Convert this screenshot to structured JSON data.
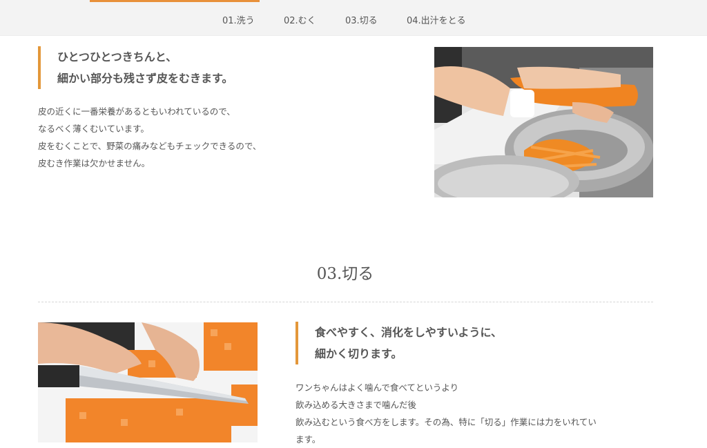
{
  "nav": {
    "items": [
      {
        "label": "01.洗う"
      },
      {
        "label": "02.むく"
      },
      {
        "label": "03.切る"
      },
      {
        "label": "04.出汁をとる"
      }
    ]
  },
  "peel_section": {
    "headline": [
      "ひとつひとつきちんと、",
      "細かい部分も残さず皮をむきます。"
    ],
    "body": [
      "皮の近くに一番栄養があるともいわれているので、",
      "なるべく薄くむいています。",
      "皮をむくことで、野菜の痛みなどもチェックできるので、",
      "皮むき作業は欠かせません。"
    ],
    "image": "carrot-peeling-photo"
  },
  "cut_section": {
    "title": "03.切る",
    "headline": [
      "食べやすく、消化をしやすいように、",
      "細かく切ります。"
    ],
    "body": [
      "ワンちゃんはよく噛んで食べてというより",
      "飲み込める大きさまで噛んだ後",
      "飲み込むという食べ方をします。その為、特に「切る」作業には力をいれてい",
      "ます。"
    ],
    "image": "carrot-dicing-photo"
  },
  "colors": {
    "accent": "#e3973a",
    "nav_bg": "#f3f3f3",
    "text": "#555555"
  }
}
